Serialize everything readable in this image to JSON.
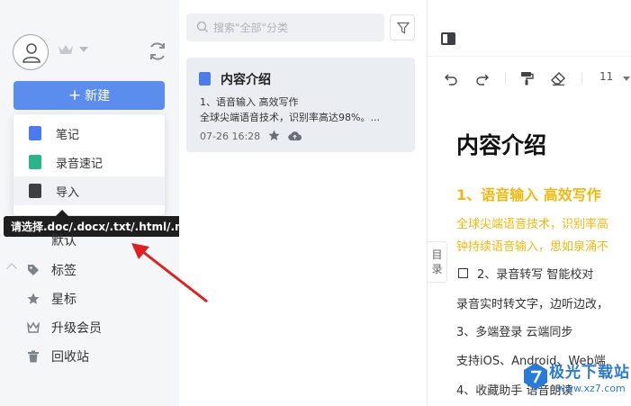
{
  "sidebar": {
    "new_button_label": "新建",
    "new_menu": [
      {
        "label": "笔记",
        "icon": "note-icon",
        "color": "#4a7cf0"
      },
      {
        "label": "录音速记",
        "icon": "voice-note-icon",
        "color": "#2bb38a"
      },
      {
        "label": "导入",
        "icon": "import-icon",
        "color": "#3d3f44"
      }
    ],
    "tooltip": "请选择.doc/.docx/.txt/.html/.md格式的文件",
    "items": [
      {
        "label": "默认",
        "icon": "folder-icon"
      },
      {
        "label": "标签",
        "icon": "tag-icon"
      },
      {
        "label": "星标",
        "icon": "star-icon"
      },
      {
        "label": "升级会员",
        "icon": "crown-icon"
      },
      {
        "label": "回收站",
        "icon": "trash-icon"
      }
    ]
  },
  "list": {
    "search_placeholder": "搜索\"全部\"分类",
    "note": {
      "title": "内容介绍",
      "line1": "1、语音输入 高效写作",
      "line2": "全球尖端语音技术，识别率高达98%。...",
      "date": "07-26 16:28"
    }
  },
  "editor": {
    "toc_label": [
      "目",
      "录"
    ],
    "font_size": "11",
    "doc": {
      "title": "内容介绍",
      "h1": "1、语音输入 高效写作",
      "hl1": "全球尖端语音技术，识别率高",
      "hl2": "钟持续语音输入，思如泉涌不",
      "p2": "2、录音转写 智能校对",
      "p3": "录音实时转文字，边听边改，",
      "p4": "3、多端登录 云端同步",
      "p5": "支持iOS、Android、Web端",
      "p6": "4、收藏助手 语音朗读"
    }
  },
  "watermark": {
    "text": "极光下载站",
    "sub": "www.xz7.com"
  },
  "colors": {
    "accent": "#5b8def",
    "highlight": "#f2b90c",
    "arrow": "#e02020"
  }
}
